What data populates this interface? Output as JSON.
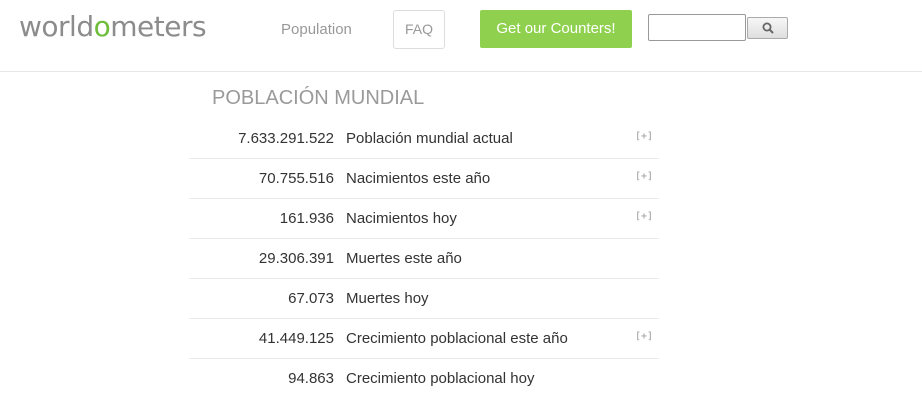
{
  "header": {
    "logo": {
      "part1": "world",
      "highlight": "o",
      "part2": "meters"
    },
    "nav": {
      "population_label": "Population",
      "faq_label": "FAQ"
    },
    "counters_button_label": "Get our Counters!",
    "search": {
      "value": "",
      "button_icon": "search-icon"
    }
  },
  "main": {
    "section_title": "POBLACIÓN MUNDIAL",
    "expand_label": "[+]",
    "stats": [
      {
        "value": "7.633.291.522",
        "label": "Población mundial actual",
        "expandable": true
      },
      {
        "value": "70.755.516",
        "label": "Nacimientos este año",
        "expandable": true
      },
      {
        "value": "161.936",
        "label": "Nacimientos hoy",
        "expandable": true
      },
      {
        "value": "29.306.391",
        "label": "Muertes este año",
        "expandable": false
      },
      {
        "value": "67.073",
        "label": "Muertes hoy",
        "expandable": false
      },
      {
        "value": "41.449.125",
        "label": "Crecimiento poblacional este año",
        "expandable": true
      },
      {
        "value": "94.863",
        "label": "Crecimiento poblacional hoy",
        "expandable": false
      }
    ]
  },
  "colors": {
    "logo_gray": "#8c8c8c",
    "logo_green": "#6fbd3b",
    "counters_button_bg": "#8fd14f",
    "muted_text": "#999999",
    "row_divider": "#e9e9e9"
  }
}
